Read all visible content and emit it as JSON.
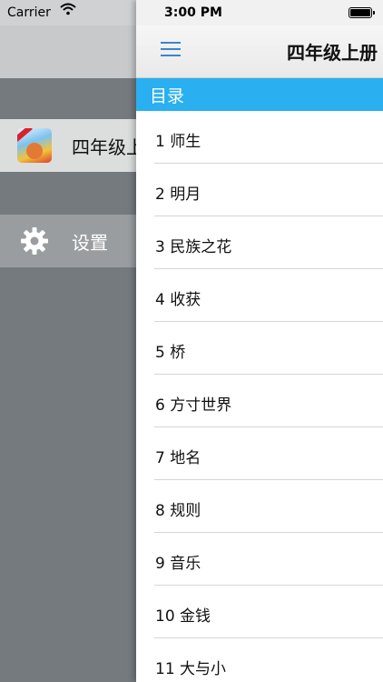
{
  "status_bar": {
    "carrier": "Carrier",
    "time": "3:00 PM"
  },
  "menu": {
    "items": [
      {
        "label": "四年级上册",
        "icon": "book-cover-icon"
      },
      {
        "label": "设置",
        "icon": "gear-icon"
      }
    ]
  },
  "navbar": {
    "title": "四年级上册",
    "menu_icon": "hamburger-icon",
    "accent": "#3a86c9"
  },
  "toc": {
    "header": "目录",
    "header_color": "#2aaff0",
    "items": [
      "1 师生",
      "2 明月",
      "3 民族之花",
      "4 收获",
      "5 桥",
      "6 方寸世界",
      "7 地名",
      "8 规则",
      "9 音乐",
      "10 金钱",
      "11 大与小"
    ]
  }
}
